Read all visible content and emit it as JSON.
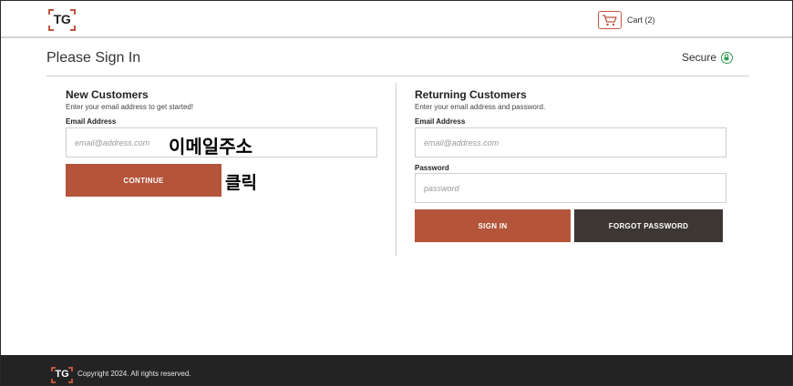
{
  "header": {
    "logo_text": "TG",
    "cart_label": "Cart (2)"
  },
  "page": {
    "title": "Please Sign In",
    "secure_label": "Secure"
  },
  "new_customers": {
    "title": "New Customers",
    "subtitle": "Enter your email address to get started!",
    "email_label": "Email Address",
    "email_placeholder": "email@address.com",
    "continue_label": "CONTINUE"
  },
  "returning_customers": {
    "title": "Returning Customers",
    "subtitle": "Enter your email address and password.",
    "email_label": "Email Address",
    "email_placeholder": "email@address.com",
    "password_label": "Password",
    "password_placeholder": "password",
    "signin_label": "SIGN IN",
    "forgot_label": "FORGOT PASSWORD"
  },
  "annotations": {
    "email_note": "이메일주소",
    "click_note": "클릭"
  },
  "footer": {
    "logo_text": "TG",
    "copyright": "Copyright 2024. All rights reserved."
  },
  "colors": {
    "accent": "#b4543a",
    "dark_button": "#3d3734",
    "footer_bg": "#232323",
    "secure_green": "#2e9a4e"
  }
}
